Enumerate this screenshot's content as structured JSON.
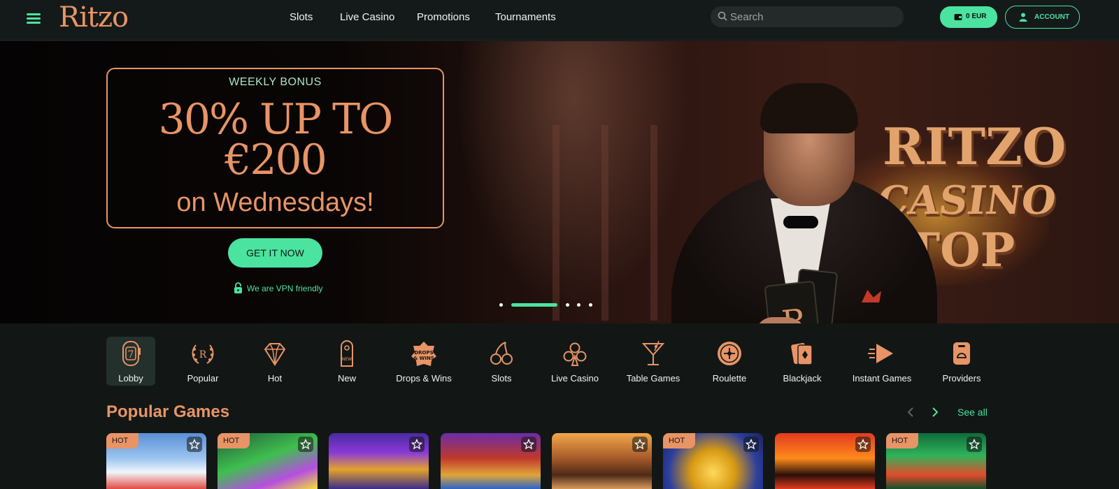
{
  "header": {
    "logo": "Ritzo",
    "nav": [
      "Slots",
      "Live Casino",
      "Promotions",
      "Tournaments"
    ],
    "search_placeholder": "Search",
    "balance": "0 EUR",
    "account": "ACCOUNT"
  },
  "hero": {
    "promo_sub": "WEEKLY BONUS",
    "promo_line1": "30% UP TO",
    "promo_line2": "€200",
    "promo_small": "on Wednesdays!",
    "cta": "GET IT NOW",
    "vpn": "We are VPN friendly",
    "sign_line1": "RITZO",
    "sign_line2": "CASINO",
    "sign_line3": "TOP",
    "card_letter": "R",
    "slides_total": 5,
    "slide_active": 2
  },
  "categories": [
    {
      "label": "Lobby",
      "icon": "slot-seven-icon"
    },
    {
      "label": "Popular",
      "icon": "laurel-icon"
    },
    {
      "label": "Hot",
      "icon": "diamond-icon"
    },
    {
      "label": "New",
      "icon": "door-tag-icon"
    },
    {
      "label": "Drops & Wins",
      "icon": "drops-wins-icon"
    },
    {
      "label": "Slots",
      "icon": "cherry-icon"
    },
    {
      "label": "Live Casino",
      "icon": "club-icon"
    },
    {
      "label": "Table Games",
      "icon": "cocktail-icon"
    },
    {
      "label": "Roulette",
      "icon": "roulette-icon"
    },
    {
      "label": "Blackjack",
      "icon": "cards-icon"
    },
    {
      "label": "Instant Games",
      "icon": "play-arrow-icon"
    },
    {
      "label": "Providers",
      "icon": "providers-icon"
    }
  ],
  "popular": {
    "title": "Popular Games",
    "see_all": "See all",
    "hot_label": "HOT",
    "games": [
      {
        "hot": true,
        "theme": "anime-girl"
      },
      {
        "hot": true,
        "theme": "frog-sunglasses"
      },
      {
        "hot": false,
        "theme": "gold-pot"
      },
      {
        "hot": false,
        "theme": "jester"
      },
      {
        "hot": false,
        "theme": "adventurer"
      },
      {
        "hot": true,
        "theme": "gold-coin"
      },
      {
        "hot": false,
        "theme": "lucky-seven"
      },
      {
        "hot": true,
        "theme": "money-stack"
      }
    ]
  },
  "colors": {
    "accent_green": "#4be3a0",
    "accent_copper": "#e89466",
    "background": "#121716"
  }
}
